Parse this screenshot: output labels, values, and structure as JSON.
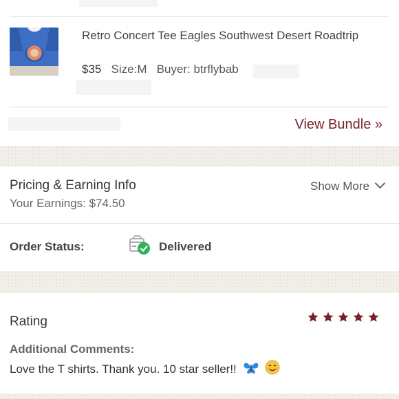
{
  "item": {
    "title": "Retro Concert Tee Eagles Southwest Desert Roadtrip",
    "price": "$35",
    "size": "Size:M",
    "buyer": "Buyer: btrflybab"
  },
  "bundle": {
    "view_label": "View Bundle »"
  },
  "pricing": {
    "title": "Pricing & Earning Info",
    "show_more": "Show More",
    "earnings": "Your Earnings: $74.50"
  },
  "order": {
    "status_label": "Order Status:",
    "status_value": "Delivered",
    "status_icon": "delivered-box-icon"
  },
  "rating": {
    "title": "Rating",
    "stars": 5,
    "comments_label": "Additional Comments:",
    "comment": "Love the T shirts. Thank you. 10 star seller!!"
  },
  "colors": {
    "accent": "#7a1f2e",
    "star": "#7a1f2e",
    "check": "#2fb35a"
  }
}
